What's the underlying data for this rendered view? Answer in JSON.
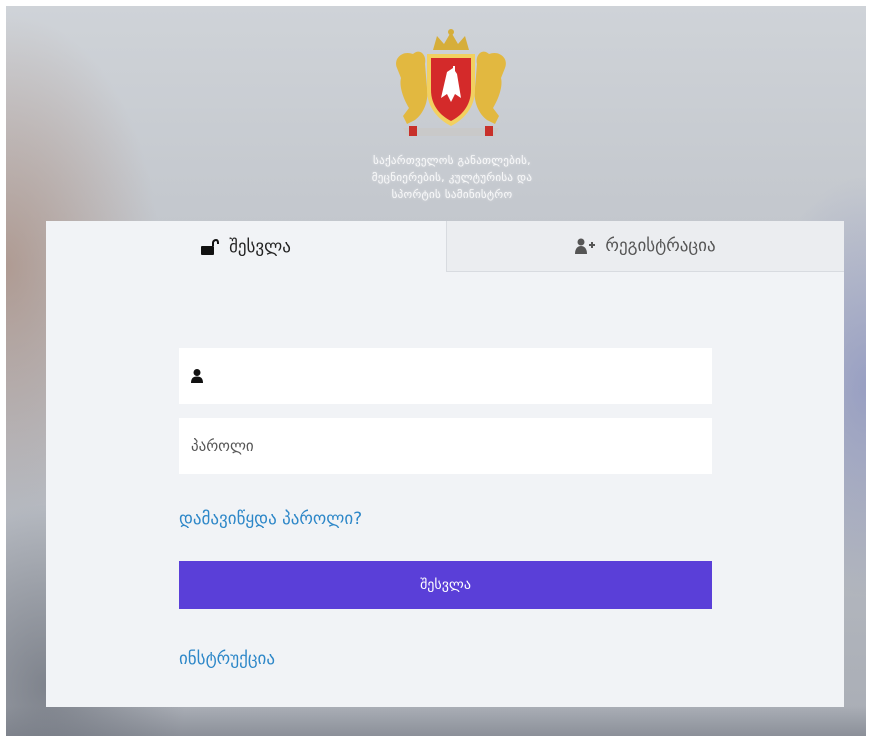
{
  "header": {
    "org_title_lines": [
      "საქართველოს განათლების,",
      "მეცნიერების, კულტურისა და",
      "სპორტის სამინისტრო"
    ]
  },
  "tabs": [
    {
      "label": "შესვლა",
      "icon": "unlock-icon",
      "active": true
    },
    {
      "label": "რეგისტრაცია",
      "icon": "user-plus-icon",
      "active": false
    }
  ],
  "form": {
    "username": {
      "value": "",
      "placeholder": "",
      "icon": "user-icon"
    },
    "password": {
      "value": "",
      "placeholder": "პაროლი"
    },
    "forgot_password_label": "დამავიწყდა პაროლი?",
    "submit_label": "შესვლა",
    "instructions_label": "ინსტრუქცია"
  },
  "colors": {
    "primary_button": "#5a3fd8",
    "link": "#2d87c8",
    "card_background": "#f1f3f6"
  }
}
